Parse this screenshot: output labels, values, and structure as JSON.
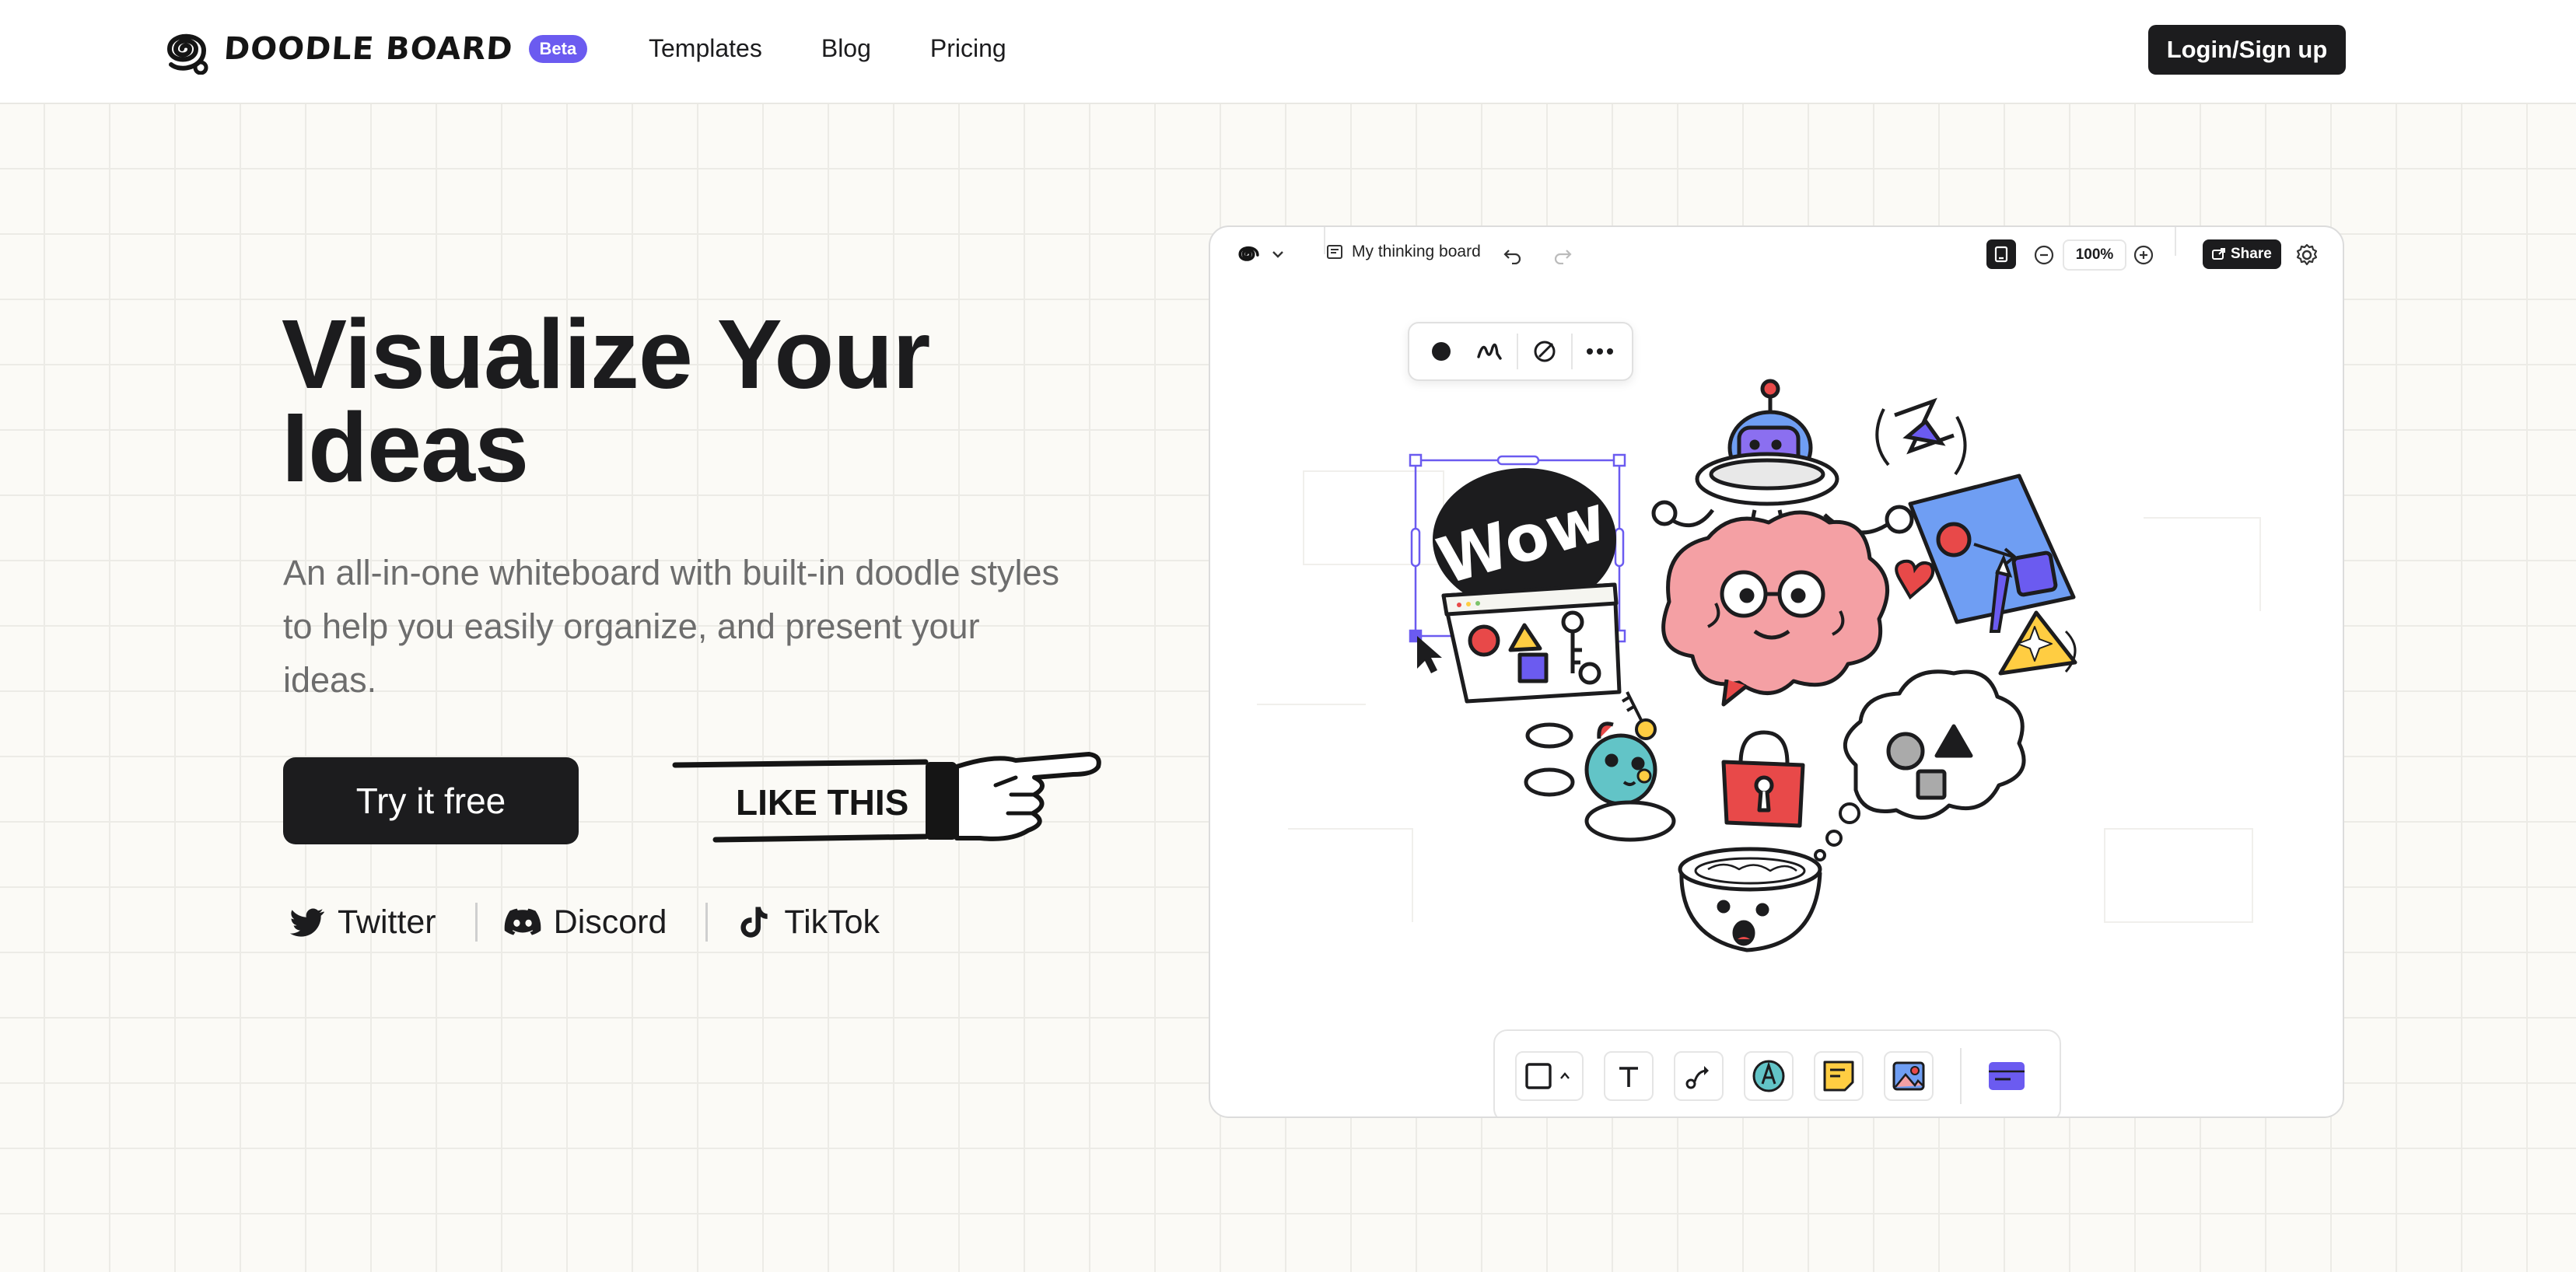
{
  "header": {
    "brand": "DOODLE BOARD",
    "badge": "Beta",
    "nav": [
      "Templates",
      "Blog",
      "Pricing"
    ],
    "login_label": "Login/Sign up"
  },
  "hero": {
    "title_line1": "Visualize Your",
    "title_line2": "Ideas",
    "subtitle": "An all-in-one whiteboard with built-in doodle styles to help you easily organize, and present your ideas.",
    "cta_label": "Try it free",
    "pointer_label": "LIKE THIS"
  },
  "socials": [
    {
      "label": "Twitter",
      "icon": "twitter-icon"
    },
    {
      "label": "Discord",
      "icon": "discord-icon"
    },
    {
      "label": "TikTok",
      "icon": "tiktok-icon"
    }
  ],
  "app_preview": {
    "board_name": "My thinking board",
    "zoom": "100%",
    "share_label": "Share",
    "doodle_text": "Wow",
    "float_tools": [
      "fill-dot-icon",
      "scribble-icon",
      "no-fill-icon",
      "more-icon"
    ],
    "bottom_tools": [
      "rectangle-icon",
      "text-icon",
      "connector-icon",
      "pen-icon",
      "sticky-note-icon",
      "image-icon",
      "library-icon"
    ]
  },
  "colors": {
    "accent": "#6b5bf0",
    "dark": "#1c1c1e",
    "brain_pink": "#f4a0a4",
    "blue_card": "#6f9ef3",
    "yellow": "#ffcd42",
    "lock_red": "#e84949"
  }
}
